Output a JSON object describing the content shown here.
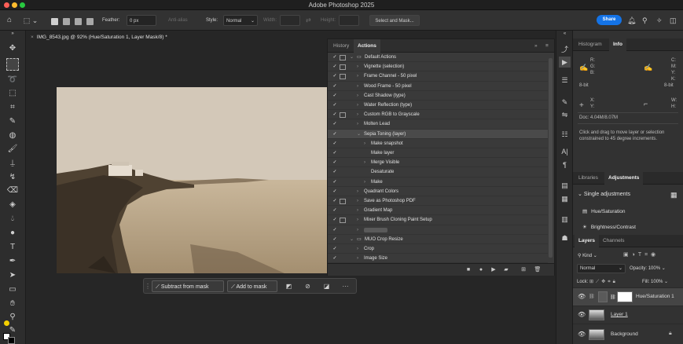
{
  "app": {
    "title": "Adobe Photoshop 2025"
  },
  "options_bar": {
    "feather_label": "Feather:",
    "feather_value": "0 px",
    "antialias_label": "Anti-alias",
    "style_label": "Style:",
    "style_value": "Normal",
    "width_label": "Width:",
    "height_label": "Height:",
    "select_mask_label": "Select and Mask...",
    "share_label": "Share"
  },
  "document": {
    "tab_title": "IMG_8543.jpg @ 92% (Hue/Saturation 1, Layer Mask/8) *"
  },
  "mask_toolbar": {
    "subtract_label": "Subtract from mask",
    "add_label": "Add to mask",
    "more_label": "···"
  },
  "actions_panel": {
    "tabs": [
      "History",
      "Actions"
    ],
    "active_tab": "Actions",
    "rows": [
      {
        "label": "Default Actions",
        "indent": 0,
        "chevron": "open",
        "folder": true,
        "dialog": true
      },
      {
        "label": "Vignette (selection)",
        "indent": 1,
        "chevron": "closed",
        "dialog": true
      },
      {
        "label": "Frame Channel - 50 pixel",
        "indent": 1,
        "chevron": "closed",
        "dialog": true
      },
      {
        "label": "Wood Frame - 50 pixel",
        "indent": 1,
        "chevron": "closed",
        "dialog": false
      },
      {
        "label": "Cast Shadow (type)",
        "indent": 1,
        "chevron": "closed",
        "dialog": false
      },
      {
        "label": "Water Reflection (type)",
        "indent": 1,
        "chevron": "closed",
        "dialog": false
      },
      {
        "label": "Custom RGB to Grayscale",
        "indent": 1,
        "chevron": "closed",
        "dialog": true
      },
      {
        "label": "Molten Lead",
        "indent": 1,
        "chevron": "closed",
        "dialog": false
      },
      {
        "label": "Sepia Toning (layer)",
        "indent": 1,
        "chevron": "open",
        "dialog": false,
        "selected": true
      },
      {
        "label": "Make snapshot",
        "indent": 2,
        "chevron": "closed",
        "dialog": false
      },
      {
        "label": "Make layer",
        "indent": 2,
        "chevron": "none",
        "dialog": false
      },
      {
        "label": "Merge Visible",
        "indent": 2,
        "chevron": "closed",
        "dialog": false
      },
      {
        "label": "Desaturate",
        "indent": 2,
        "chevron": "none",
        "dialog": false
      },
      {
        "label": "Make",
        "indent": 2,
        "chevron": "closed",
        "dialog": false
      },
      {
        "label": "Quadrant Colors",
        "indent": 1,
        "chevron": "closed",
        "dialog": false
      },
      {
        "label": "Save as Photoshop PDF",
        "indent": 1,
        "chevron": "closed",
        "dialog": true
      },
      {
        "label": "Gradient Map",
        "indent": 1,
        "chevron": "closed",
        "dialog": false
      },
      {
        "label": "Mixer Brush Cloning Paint Setup",
        "indent": 1,
        "chevron": "closed",
        "dialog": true
      },
      {
        "label": "",
        "indent": 1,
        "chevron": "closed",
        "dialog": false
      },
      {
        "label": "MUO Crop Resize",
        "indent": 0,
        "chevron": "open",
        "folder": true,
        "dialog": false
      },
      {
        "label": "Crop",
        "indent": 1,
        "chevron": "closed",
        "dialog": false
      },
      {
        "label": "Image Size",
        "indent": 1,
        "chevron": "closed",
        "dialog": false
      }
    ]
  },
  "info_panel": {
    "tabs": [
      "Histogram",
      "Info"
    ],
    "active_tab": "Info",
    "r_label": "R:",
    "g_label": "G:",
    "b_label": "B:",
    "c_label": "C:",
    "m_label": "M:",
    "y_label": "Y:",
    "k_label": "K:",
    "bit_left": "8-bit",
    "bit_right": "8-bit",
    "x_label": "X:",
    "y2_label": "Y:",
    "w_label": "W:",
    "h_label": "H:",
    "doc_size": "Doc: 4.04M/8.07M",
    "hint": "Click and drag to move layer or selection constrained to 45 degree increments."
  },
  "adjustments_panel": {
    "tabs": [
      "Libraries",
      "Adjustments"
    ],
    "active_tab": "Adjustments",
    "section_title": "Single adjustments",
    "items": [
      "Hue/Saturation",
      "Brightness/Contrast"
    ]
  },
  "layers_panel": {
    "tabs": [
      "Layers",
      "Channels"
    ],
    "active_tab": "Layers",
    "kind_label": "Kind",
    "blend_mode": "Normal",
    "opacity_label": "Opacity:",
    "opacity_value": "100%",
    "lock_label": "Lock:",
    "fill_label": "Fill:",
    "fill_value": "100%",
    "layers": [
      {
        "name": "Hue/Saturation 1"
      },
      {
        "name": "Layer 1"
      },
      {
        "name": "Background"
      }
    ]
  },
  "colors": {
    "accent": "#1473e6",
    "selected_row": "#4a4a4a",
    "panel": "#323232"
  }
}
